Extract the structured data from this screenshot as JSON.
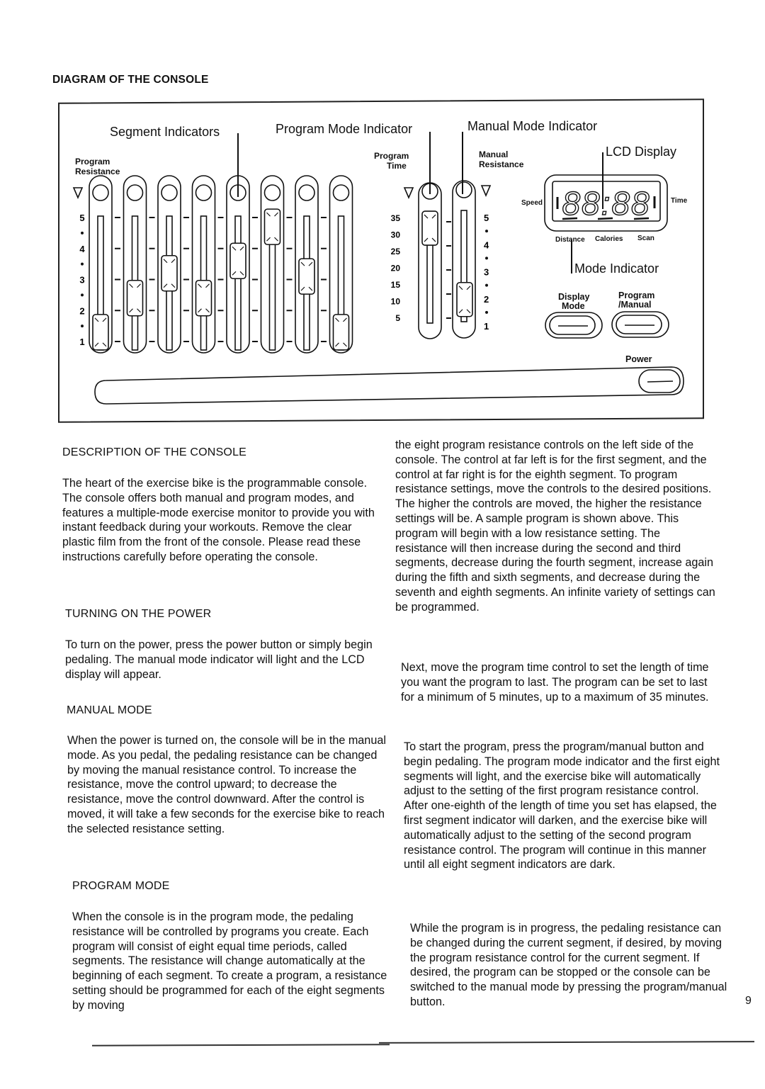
{
  "diagram": {
    "title": "DIAGRAM OF THE CONSOLE",
    "callouts": {
      "segment_indicators": "Segment Indicators",
      "program_mode_indicator": "Program Mode Indicator",
      "manual_mode_indicator": "Manual Mode Indicator",
      "lcd_display": "LCD Display",
      "mode_indicator": "Mode Indicator"
    },
    "program_resistance": {
      "label_line1": "Program",
      "label_line2": "Resistance",
      "scale": [
        "5",
        "4",
        "3",
        "2",
        "1"
      ],
      "segment_settings": [
        1.3,
        2.4,
        3.2,
        2.4,
        3.6,
        4.7,
        3.1,
        1.3
      ]
    },
    "program_time": {
      "label_line1": "Program",
      "label_line2": "Time",
      "scale": [
        "35",
        "30",
        "25",
        "20",
        "15",
        "10",
        "5"
      ],
      "setting_minutes": 32
    },
    "manual_resistance": {
      "label_line1": "Manual",
      "label_line2": "Resistance",
      "scale": [
        "5",
        "4",
        "3",
        "2",
        "1"
      ],
      "setting": 2.0
    },
    "lcd": {
      "digits": "88:88",
      "left_label": "Speed",
      "right_label": "Time",
      "bottom_labels": [
        "Distance",
        "Calories",
        "Scan"
      ]
    },
    "buttons": {
      "display_mode_line1": "Display",
      "display_mode_line2": "Mode",
      "program_manual_line1": "Program",
      "program_manual_line2": "/Manual",
      "power": "Power"
    }
  },
  "sections": {
    "description": {
      "heading": "DESCRIPTION OF THE CONSOLE",
      "body": "The heart of the exercise bike is the programmable console. The console offers both manual and program modes, and features a multiple-mode exercise monitor to provide you with instant feedback during your workouts. Remove the clear plastic film from the front of the console. Please read these instructions carefully before operating the console."
    },
    "power": {
      "heading": "TURNING ON THE POWER",
      "body": "To turn on the power, press the power button or simply begin pedaling. The manual mode indicator will light and the LCD display will appear."
    },
    "manual": {
      "heading": "MANUAL MODE",
      "body": "When the power is turned on, the console will be in the manual mode. As you pedal, the pedaling resistance can be changed by moving the manual resistance control. To increase the resistance, move the control upward; to decrease the resistance, move the control downward. After the control is moved, it will take a few seconds for the exercise bike to reach the selected resistance setting."
    },
    "program": {
      "heading": "PROGRAM MODE",
      "body_left": "When the console is in the program mode, the pedaling resistance will be controlled by programs you create. Each program will consist of eight equal time periods, called segments. The resistance will change automatically at the beginning of each segment. To create a program, a resistance setting should be programmed for each of the eight segments by moving",
      "body_right_1": "the eight program resistance controls on the left side of the console. The control at far left is for the first segment, and the control at far right is for the eighth segment. To program resistance settings, move the controls to the desired positions. The higher the controls are moved, the higher the resistance settings will be. A sample program is shown above. This program will begin with a low resistance setting. The resistance will then increase during the second and third segments, decrease during the fourth segment, increase again during the fifth and sixth segments, and decrease during the seventh and eighth segments. An infinite variety of settings can be programmed.",
      "body_right_2": "Next, move the program time control to set the length of time you want the program to last. The program can be set to last for a minimum of 5 minutes, up to a maximum of 35 minutes.",
      "body_right_3": "To start the program, press the program/manual button and begin pedaling. The program mode indicator and the first eight segments will light, and the exercise bike will automatically adjust to the setting of the first program resistance control. After one-eighth of the length of time you set has elapsed, the first segment indicator will darken, and the exercise bike will automatically adjust to the setting of the second program resistance control. The program will continue in this manner until all eight segment indicators are dark.",
      "body_right_4": "While the program is in progress, the pedaling resistance can be changed during the current segment, if desired, by moving the program resistance control for the current segment. If desired, the program can be stopped or the console can be switched to the manual mode by pressing the program/manual button."
    }
  },
  "page_number": "9"
}
